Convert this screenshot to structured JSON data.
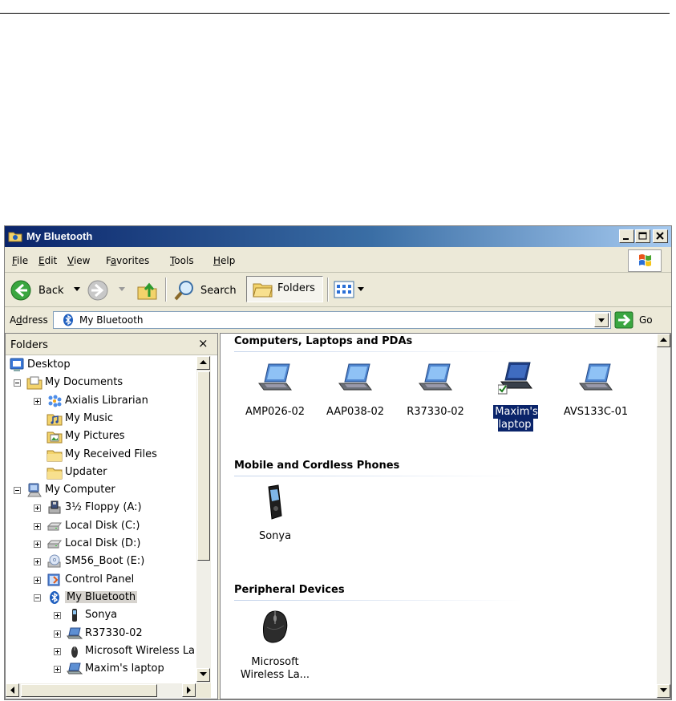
{
  "window": {
    "title": "My Bluetooth",
    "buttons": [
      "minimize",
      "maximize",
      "close"
    ]
  },
  "menu": [
    {
      "label_pre": "",
      "label_u": "F",
      "label_post": "ile"
    },
    {
      "label_pre": "",
      "label_u": "E",
      "label_post": "dit"
    },
    {
      "label_pre": "",
      "label_u": "V",
      "label_post": "iew"
    },
    {
      "label_pre": "F",
      "label_u": "a",
      "label_post": "vorites"
    },
    {
      "label_pre": "",
      "label_u": "T",
      "label_post": "ools"
    },
    {
      "label_pre": "",
      "label_u": "H",
      "label_post": "elp"
    }
  ],
  "toolbar": {
    "back_label": "Back",
    "search_label": "Search",
    "folders_label": "Folders"
  },
  "address": {
    "label_pre": "A",
    "label_u": "d",
    "label_post": "dress",
    "value": "My Bluetooth",
    "go_label": "Go"
  },
  "folders": {
    "title": "Folders",
    "close": "×",
    "tree": [
      {
        "label": "Desktop",
        "icon": "desktop-icon",
        "expander": "none"
      },
      {
        "label": "My Documents",
        "icon": "my-documents-icon",
        "expander": "minus"
      },
      {
        "label": "Axialis Librarian",
        "icon": "axialis-icon",
        "expander": "plus"
      },
      {
        "label": "My Music",
        "icon": "music-folder-icon",
        "expander": "none"
      },
      {
        "label": "My Pictures",
        "icon": "pictures-folder-icon",
        "expander": "none"
      },
      {
        "label": "My Received Files",
        "icon": "folder-icon",
        "expander": "none"
      },
      {
        "label": "Updater",
        "icon": "folder-icon",
        "expander": "none"
      },
      {
        "label": "My Computer",
        "icon": "computer-icon",
        "expander": "minus"
      },
      {
        "label": "3½ Floppy (A:)",
        "icon": "floppy-icon",
        "expander": "plus"
      },
      {
        "label": "Local Disk (C:)",
        "icon": "disk-icon",
        "expander": "plus"
      },
      {
        "label": "Local Disk (D:)",
        "icon": "disk-icon",
        "expander": "plus"
      },
      {
        "label": "SM56_Boot (E:)",
        "icon": "cd-drive-icon",
        "expander": "plus"
      },
      {
        "label": "Control Panel",
        "icon": "control-panel-icon",
        "expander": "plus"
      },
      {
        "label": "My Bluetooth",
        "icon": "bluetooth-icon",
        "expander": "minus",
        "selected": true
      },
      {
        "label": "Sonya",
        "icon": "phone-icon",
        "expander": "plus"
      },
      {
        "label": "R37330-02",
        "icon": "laptop-icon",
        "expander": "plus"
      },
      {
        "label": "Microsoft Wireless La",
        "icon": "mouse-icon",
        "expander": "plus"
      },
      {
        "label": "Maxim's laptop",
        "icon": "laptop-icon",
        "expander": "plus"
      }
    ]
  },
  "groups": [
    {
      "title": "Computers, Laptops and PDAs",
      "items": [
        {
          "label": "AMP026-02",
          "icon": "laptop-icon"
        },
        {
          "label": "AAP038-02",
          "icon": "laptop-icon"
        },
        {
          "label": "R37330-02",
          "icon": "laptop-icon"
        },
        {
          "label": "Maxim's laptop",
          "icon": "laptop-paired-icon",
          "selected": true
        },
        {
          "label": "AVS133C-01",
          "icon": "laptop-icon"
        }
      ]
    },
    {
      "title": "Mobile and Cordless Phones",
      "items": [
        {
          "label": "Sonya",
          "icon": "phone-icon"
        }
      ]
    },
    {
      "title": "Peripheral Devices",
      "items": [
        {
          "label": "Microsoft Wireless La...",
          "label_line1": "Microsoft",
          "label_line2": "Wireless La...",
          "icon": "mouse-icon"
        }
      ]
    }
  ],
  "colors": {
    "title_gradient_start": "#0a246a",
    "title_gradient_end": "#a6caf0",
    "chrome": "#ece9d8",
    "selection": "#0a246a"
  }
}
